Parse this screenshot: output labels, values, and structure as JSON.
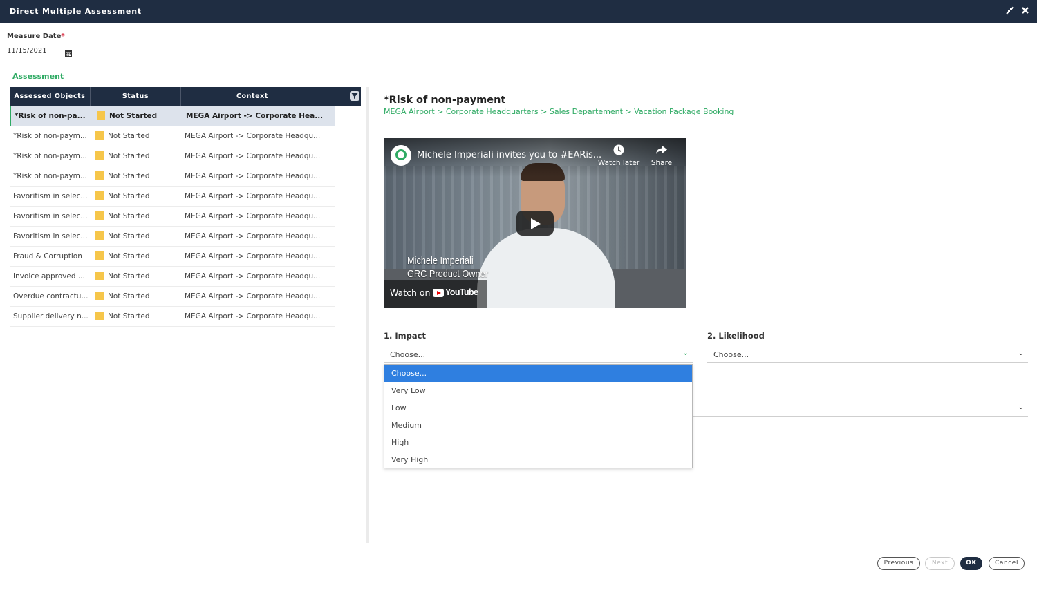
{
  "window": {
    "title": "Direct Multiple Assessment",
    "icons": [
      "minimize-icon",
      "close-icon"
    ]
  },
  "measure_date": {
    "label": "Measure Date",
    "required_mark": "*",
    "value": "11/15/2021",
    "icon": "calendar-icon"
  },
  "assessment": {
    "section_title": "Assessment",
    "columns": [
      "Assessed Objects",
      "Status",
      "Context"
    ],
    "rows": [
      {
        "object": "*Risk of non-pa...",
        "status": "Not Started",
        "context": "MEGA Airport -> Corporate Hea..."
      },
      {
        "object": "*Risk of non-paym...",
        "status": "Not Started",
        "context": "MEGA Airport -> Corporate Headqu..."
      },
      {
        "object": "*Risk of non-paym...",
        "status": "Not Started",
        "context": "MEGA Airport -> Corporate Headqu..."
      },
      {
        "object": "*Risk of non-paym...",
        "status": "Not Started",
        "context": "MEGA Airport -> Corporate Headqu..."
      },
      {
        "object": "Favoritism in selec...",
        "status": "Not Started",
        "context": "MEGA Airport -> Corporate Headqu..."
      },
      {
        "object": "Favoritism in selec...",
        "status": "Not Started",
        "context": "MEGA Airport -> Corporate Headqu..."
      },
      {
        "object": "Favoritism in selec...",
        "status": "Not Started",
        "context": "MEGA Airport -> Corporate Headqu..."
      },
      {
        "object": "Fraud & Corruption",
        "status": "Not Started",
        "context": "MEGA Airport -> Corporate Headqu..."
      },
      {
        "object": "Invoice approved ...",
        "status": "Not Started",
        "context": "MEGA Airport -> Corporate Headqu..."
      },
      {
        "object": "Overdue contractu...",
        "status": "Not Started",
        "context": "MEGA Airport -> Corporate Headqu..."
      },
      {
        "object": "Supplier delivery n...",
        "status": "Not Started",
        "context": "MEGA Airport -> Corporate Headqu..."
      }
    ]
  },
  "detail": {
    "title": "*Risk of non-payment",
    "breadcrumb": "MEGA Airport > Corporate Headquarters > Sales Departement > Vacation Package Booking"
  },
  "video": {
    "title": "Michele Imperiali invites you to #EARis...",
    "watch_later": "Watch later",
    "share": "Share",
    "caption_line1": "Michele Imperiali",
    "caption_line2": "GRC Product Owner",
    "watch_on": "Watch on",
    "youtube": "YouTube"
  },
  "impact": {
    "label": "1. Impact",
    "value": "Choose...",
    "options": [
      "Choose...",
      "Very Low",
      "Low",
      "Medium",
      "High",
      "Very High"
    ],
    "highlighted": "Choose..."
  },
  "likelihood": {
    "label": "2. Likelihood",
    "value": "Choose..."
  },
  "footer": {
    "previous": "Previous",
    "next": "Next",
    "ok": "OK",
    "cancel": "Cancel"
  },
  "colors": {
    "header_bg": "#1f2d42",
    "accent_green": "#2eaa63",
    "status_yellow": "#f6c64a",
    "option_highlight": "#2f7fe0"
  }
}
